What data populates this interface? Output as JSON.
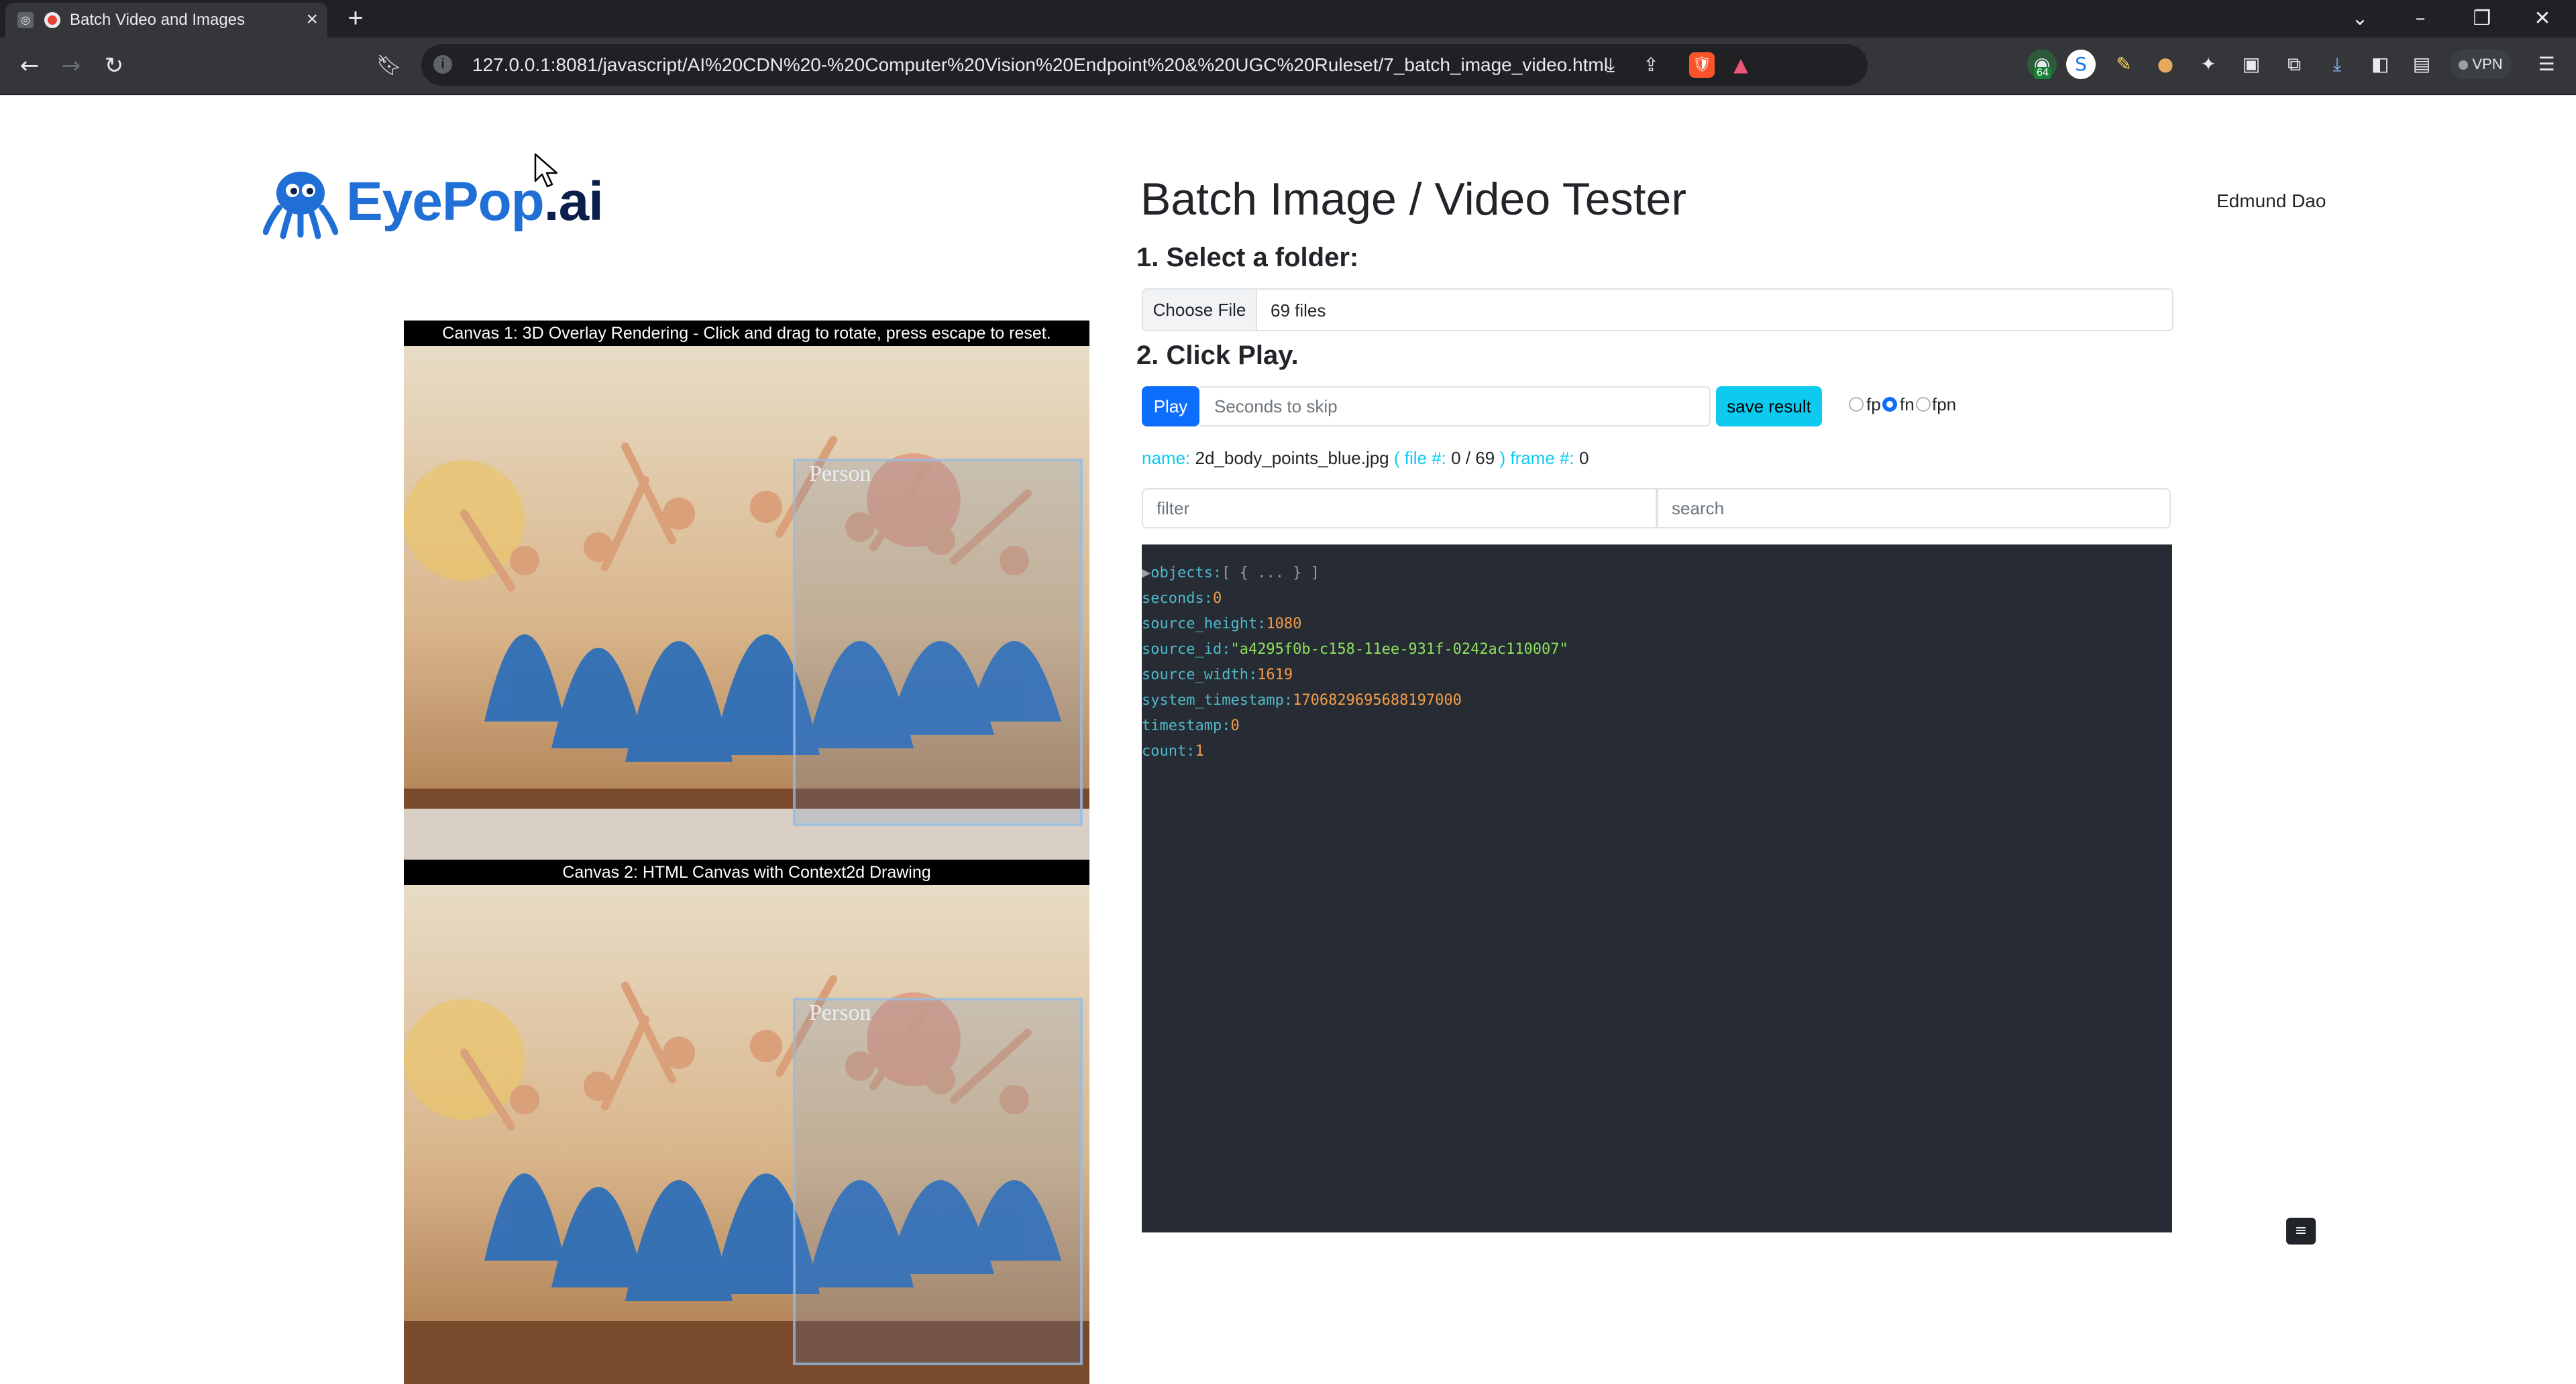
{
  "browser": {
    "tab_title": "Batch Video and Images",
    "url": "127.0.0.1:8081/javascript/AI%20CDN%20-%20Computer%20Vision%20Endpoint%20&%20UGC%20Ruleset/7_batch_image_video.html",
    "vpn_label": "VPN",
    "extension_badge": "64"
  },
  "logo": {
    "text_main": "EyePop",
    "text_suffix": ".ai"
  },
  "header": {
    "title": "Batch Image / Video Tester",
    "user_name": "Edmund Dao"
  },
  "steps": {
    "step1": "1. Select a folder:",
    "step2": "2. Click Play."
  },
  "file_picker": {
    "button_label": "Choose File",
    "status": "69 files"
  },
  "controls": {
    "play_label": "Play",
    "skip_placeholder": "Seconds to skip",
    "save_label": "save result",
    "radio_options": [
      "fp",
      "fn",
      "fpn"
    ],
    "radio_selected": "fn"
  },
  "meta": {
    "name_key": "name:",
    "name_value": "2d_body_points_blue.jpg",
    "file_key_open": "( file #:",
    "file_value": "0 / 69",
    "file_key_close": ")",
    "frame_key": "frame #:",
    "frame_value": "0"
  },
  "filter_placeholder": "filter",
  "search_placeholder": "search",
  "json_view": {
    "objects_key": "objects:",
    "objects_value": "[ { ... } ]",
    "rows": [
      {
        "key": "seconds:",
        "value": "0",
        "kind": "number"
      },
      {
        "key": "source_height:",
        "value": "1080",
        "kind": "number"
      },
      {
        "key": "source_id:",
        "value": "\"a4295f0b-c158-11ee-931f-0242ac110007\"",
        "kind": "string"
      },
      {
        "key": "source_width:",
        "value": "1619",
        "kind": "number"
      },
      {
        "key": "system_timestamp:",
        "value": "1706829695688197000",
        "kind": "number"
      },
      {
        "key": "timestamp:",
        "value": "0",
        "kind": "number"
      },
      {
        "key": "count:",
        "value": "1",
        "kind": "number"
      }
    ]
  },
  "canvas1": {
    "caption": "Canvas 1: 3D Overlay Rendering - Click and drag to rotate, press escape to reset.",
    "label": "Person"
  },
  "canvas2": {
    "caption": "Canvas 2: HTML Canvas with Context2d Drawing",
    "label": "Person"
  },
  "colors": {
    "primary": "#0d6efd",
    "info": "#0dcaf0",
    "panel_bg": "#272c34",
    "brand_blue": "#1f6fd6"
  },
  "icons": {
    "back": "arrow-left-icon",
    "forward": "arrow-right-icon",
    "reload": "reload-icon",
    "bookmark": "bookmark-icon",
    "download": "download-icon",
    "share": "share-icon"
  }
}
